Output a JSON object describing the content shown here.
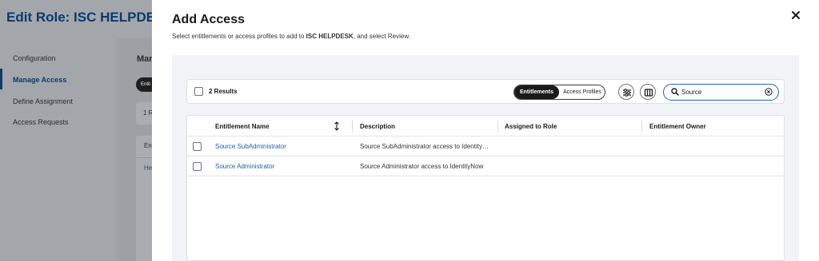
{
  "background": {
    "page_title": "Edit Role: ISC HELPDESK",
    "nav": [
      {
        "label": "Configuration"
      },
      {
        "label": "Manage Access"
      },
      {
        "label": "Define Assignment"
      },
      {
        "label": "Access Requests"
      }
    ],
    "main_heading": "Man",
    "pill_label": "Entit",
    "card_text": "1 R",
    "table_header": "Ent",
    "table_link": "He"
  },
  "modal": {
    "title": "Add Access",
    "subtitle_pre": "Select entitlements or access profiles to add to ",
    "subtitle_bold": "ISC HELPDESK",
    "subtitle_post": ", and select Review.",
    "toolbar": {
      "results_label": "2 Results",
      "segments": [
        "Entitlements",
        "Access Profiles"
      ],
      "search_value": "Source"
    },
    "table": {
      "columns": [
        "Entitlement Name",
        "Description",
        "Assigned to Role",
        "Entitlement Owner"
      ],
      "rows": [
        {
          "name": "Source SubAdministrator",
          "description": "Source SubAdministrator access to IdentityNow",
          "assigned": "",
          "owner": ""
        },
        {
          "name": "Source Administrator",
          "description": "Source Administrator access to IdentityNow",
          "assigned": "",
          "owner": ""
        }
      ]
    }
  },
  "colors": {
    "accent": "#2565b8",
    "link": "#1f5fa8",
    "title_blue": "#0b3a6e"
  },
  "icons": [
    "close-icon",
    "filter-icon",
    "columns-icon",
    "search-icon",
    "clear-icon",
    "sort-icon"
  ]
}
